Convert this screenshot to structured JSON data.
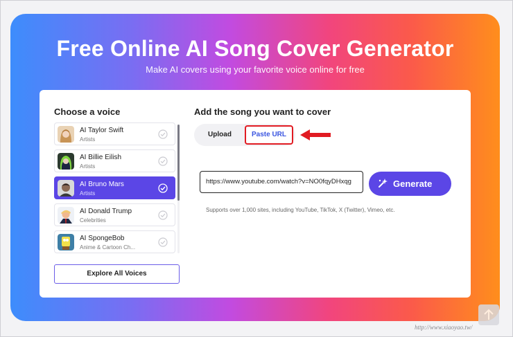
{
  "hero": {
    "title": "Free Online AI Song Cover Generator",
    "subtitle": "Make AI covers using your favorite voice online for free"
  },
  "voices": {
    "heading": "Choose a voice",
    "items": [
      {
        "name": "AI Taylor Swift",
        "category": "Artists",
        "selected": false
      },
      {
        "name": "AI Billie Eilish",
        "category": "Artists",
        "selected": false
      },
      {
        "name": "AI Bruno Mars",
        "category": "Artists",
        "selected": true
      },
      {
        "name": "AI Donald Trump",
        "category": "Celebrities",
        "selected": false
      },
      {
        "name": "AI SpongeBob",
        "category": "Anime & Cartoon Ch...",
        "selected": false
      }
    ],
    "explore_label": "Explore All Voices"
  },
  "song": {
    "heading": "Add the song you want to cover",
    "tabs": [
      {
        "label": "Upload",
        "active": false
      },
      {
        "label": "Paste URL",
        "active": true
      }
    ],
    "url_value": "https://www.youtube.com/watch?v=NO0fqyDHxqg",
    "generate_label": "Generate",
    "support_note": "Supports over 1,000 sites, including YouTube, TikTok, X (Twitter), Vimeo, etc."
  },
  "watermark": "http://www.xiaoyao.tw/",
  "colors": {
    "accent": "#5b46e6",
    "highlight": "#e11b22",
    "link": "#3a55e0"
  }
}
